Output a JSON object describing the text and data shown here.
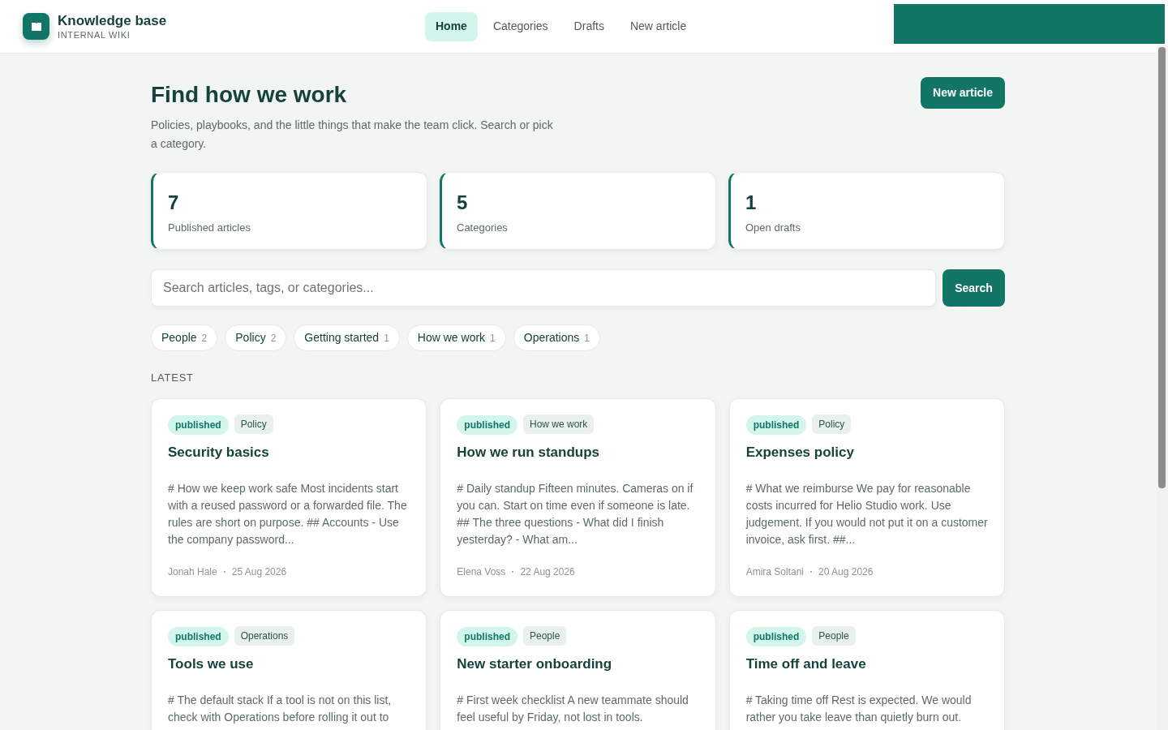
{
  "brand": {
    "title": "Knowledge base",
    "subtitle": "INTERNAL WIKI"
  },
  "nav": [
    {
      "label": "Home",
      "selected": true
    },
    {
      "label": "Categories",
      "selected": false
    },
    {
      "label": "Drafts",
      "selected": false
    },
    {
      "label": "New article",
      "selected": false
    }
  ],
  "hero": {
    "title": "Find how we work",
    "description": "Policies, playbooks, and the little things that make the team click. Search or pick a category.",
    "button": "New article"
  },
  "stats": [
    {
      "value": "7",
      "label": "Published articles"
    },
    {
      "value": "5",
      "label": "Categories"
    },
    {
      "value": "1",
      "label": "Open drafts"
    }
  ],
  "search": {
    "placeholder": "Search articles, tags, or categories...",
    "button": "Search"
  },
  "categories": [
    {
      "label": "People",
      "count": "2"
    },
    {
      "label": "Policy",
      "count": "2"
    },
    {
      "label": "Getting started",
      "count": "1"
    },
    {
      "label": "How we work",
      "count": "1"
    },
    {
      "label": "Operations",
      "count": "1"
    }
  ],
  "section_title": "LATEST",
  "articles": [
    {
      "status": "published",
      "category": "Policy",
      "title": "Security basics",
      "excerpt": "# How we keep work safe Most incidents start with a reused password or a forwarded file. The rules are short on purpose. ## Accounts - Use the company password...",
      "author": "Jonah Hale",
      "date": "25 Aug 2026"
    },
    {
      "status": "published",
      "category": "How we work",
      "title": "How we run standups",
      "excerpt": "# Daily standup Fifteen minutes. Cameras on if you can. Start on time even if someone is late. ## The three questions - What did I finish yesterday? - What am...",
      "author": "Elena Voss",
      "date": "22 Aug 2026"
    },
    {
      "status": "published",
      "category": "Policy",
      "title": "Expenses policy",
      "excerpt": "# What we reimburse We pay for reasonable costs incurred for Helio Studio work. Use judgement. If you would not put it on a customer invoice, ask first. ##...",
      "author": "Amira Soltani",
      "date": "20 Aug 2026"
    },
    {
      "status": "published",
      "category": "Operations",
      "title": "Tools we use",
      "excerpt": "# The default stack If a tool is not on this list, check with Operations before rolling it out to"
    },
    {
      "status": "published",
      "category": "People",
      "title": "New starter onboarding",
      "excerpt": "# First week checklist A new teammate should feel useful by Friday, not lost in tools."
    },
    {
      "status": "published",
      "category": "People",
      "title": "Time off and leave",
      "excerpt": "# Taking time off Rest is expected. We would rather you take leave than quietly burn out."
    }
  ]
}
